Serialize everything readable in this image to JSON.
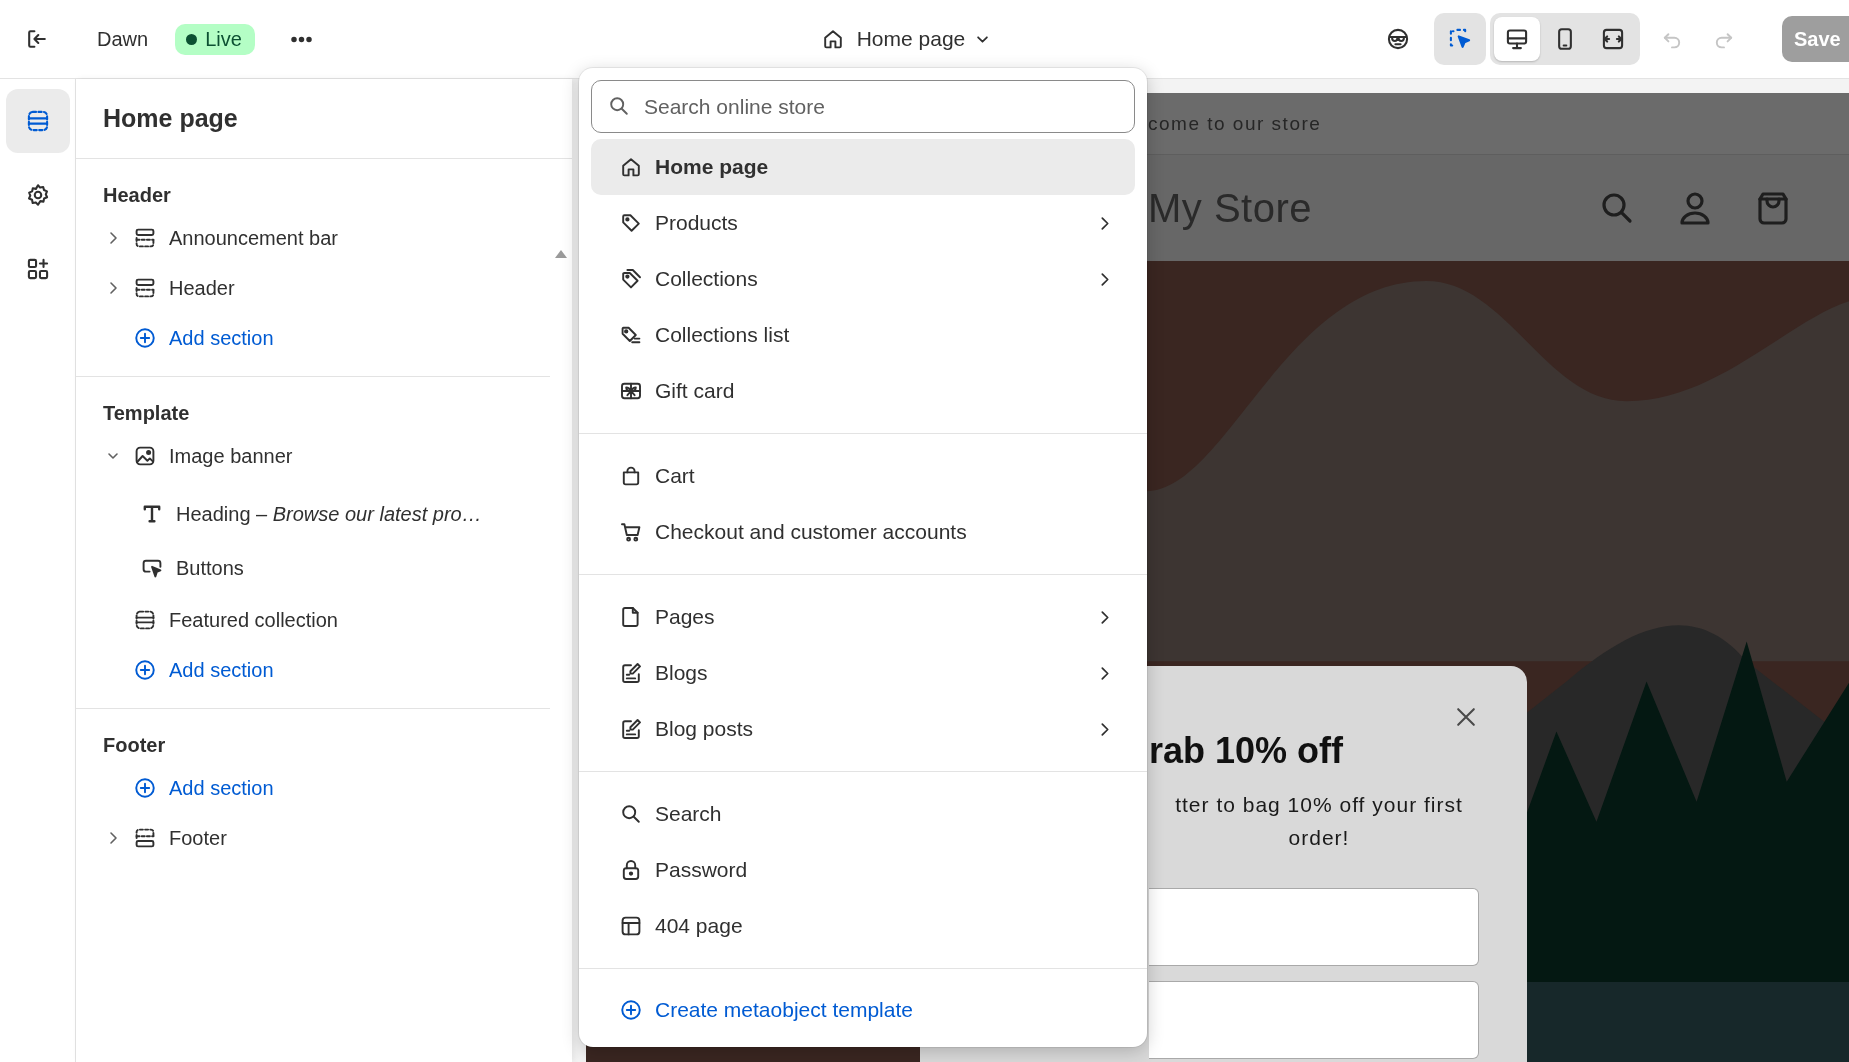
{
  "topbar": {
    "theme": "Dawn",
    "status": "Live",
    "page_selector": "Home page",
    "inspector": {
      "selected": true
    },
    "devices": [
      {
        "selected": true
      },
      {
        "selected": false
      },
      {
        "selected": false
      }
    ],
    "history": [
      {
        "disabled": true
      },
      {
        "disabled": true
      }
    ],
    "save": {
      "label": "Save",
      "disabled": true
    }
  },
  "rail": [
    {
      "selected": true
    },
    {
      "selected": false
    },
    {
      "selected": false
    }
  ],
  "panel": {
    "title": "Home page",
    "groups": [
      {
        "heading": "Header",
        "items": [
          {
            "kind": "section",
            "label": "Announcement bar",
            "expanded": false
          },
          {
            "kind": "section",
            "label": "Header",
            "expanded": false
          },
          {
            "kind": "add",
            "label": "Add section"
          }
        ]
      },
      {
        "heading": "Template",
        "items": [
          {
            "kind": "section",
            "label": "Image banner",
            "expanded": true,
            "children": [
              {
                "kind": "block",
                "label": "Heading – *Browse our latest pro…*"
              },
              {
                "kind": "block",
                "label": "Buttons"
              }
            ]
          },
          {
            "kind": "section",
            "label": "Featured collection"
          },
          {
            "kind": "add",
            "label": "Add section"
          }
        ]
      },
      {
        "heading": "Footer",
        "items": [
          {
            "kind": "add",
            "label": "Add section"
          },
          {
            "kind": "section",
            "label": "Footer",
            "expanded": false
          }
        ]
      }
    ]
  },
  "menu": {
    "search": {
      "placeholder": "Search online store"
    },
    "groups": [
      [
        {
          "label": "Home page",
          "selected": true,
          "submenu": false
        },
        {
          "label": "Products",
          "selected": false,
          "submenu": true
        },
        {
          "label": "Collections",
          "selected": false,
          "submenu": true
        },
        {
          "label": "Collections list",
          "selected": false,
          "submenu": false
        },
        {
          "label": "Gift card",
          "selected": false,
          "submenu": false
        }
      ],
      [
        {
          "label": "Cart",
          "selected": false,
          "submenu": false
        },
        {
          "label": "Checkout and customer accounts",
          "selected": false,
          "submenu": false
        }
      ],
      [
        {
          "label": "Pages",
          "selected": false,
          "submenu": true
        },
        {
          "label": "Blogs",
          "selected": false,
          "submenu": true
        },
        {
          "label": "Blog posts",
          "selected": false,
          "submenu": true
        }
      ],
      [
        {
          "label": "Search",
          "selected": false,
          "submenu": false
        },
        {
          "label": "Password",
          "selected": false,
          "submenu": false
        },
        {
          "label": "404 page",
          "selected": false,
          "submenu": false
        }
      ]
    ],
    "action": "Create metaobject template"
  },
  "preview": {
    "announcement": "come to our store",
    "store_name": "My Store",
    "popup": {
      "title": "rab 10% off",
      "text": "tter to bag 10% off your first order!"
    }
  }
}
